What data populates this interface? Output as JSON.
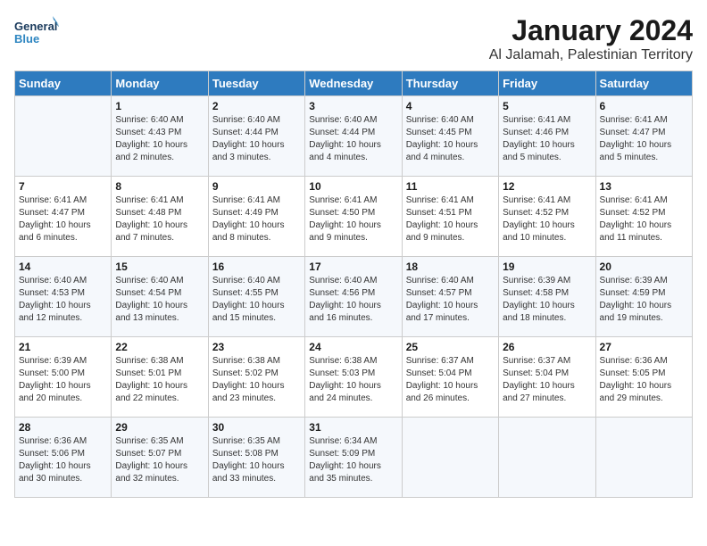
{
  "header": {
    "logo_line1": "General",
    "logo_line2": "Blue",
    "month": "January 2024",
    "location": "Al Jalamah, Palestinian Territory"
  },
  "weekdays": [
    "Sunday",
    "Monday",
    "Tuesday",
    "Wednesday",
    "Thursday",
    "Friday",
    "Saturday"
  ],
  "weeks": [
    [
      {
        "day": "",
        "info": ""
      },
      {
        "day": "1",
        "info": "Sunrise: 6:40 AM\nSunset: 4:43 PM\nDaylight: 10 hours\nand 2 minutes."
      },
      {
        "day": "2",
        "info": "Sunrise: 6:40 AM\nSunset: 4:44 PM\nDaylight: 10 hours\nand 3 minutes."
      },
      {
        "day": "3",
        "info": "Sunrise: 6:40 AM\nSunset: 4:44 PM\nDaylight: 10 hours\nand 4 minutes."
      },
      {
        "day": "4",
        "info": "Sunrise: 6:40 AM\nSunset: 4:45 PM\nDaylight: 10 hours\nand 4 minutes."
      },
      {
        "day": "5",
        "info": "Sunrise: 6:41 AM\nSunset: 4:46 PM\nDaylight: 10 hours\nand 5 minutes."
      },
      {
        "day": "6",
        "info": "Sunrise: 6:41 AM\nSunset: 4:47 PM\nDaylight: 10 hours\nand 5 minutes."
      }
    ],
    [
      {
        "day": "7",
        "info": "Sunrise: 6:41 AM\nSunset: 4:47 PM\nDaylight: 10 hours\nand 6 minutes."
      },
      {
        "day": "8",
        "info": "Sunrise: 6:41 AM\nSunset: 4:48 PM\nDaylight: 10 hours\nand 7 minutes."
      },
      {
        "day": "9",
        "info": "Sunrise: 6:41 AM\nSunset: 4:49 PM\nDaylight: 10 hours\nand 8 minutes."
      },
      {
        "day": "10",
        "info": "Sunrise: 6:41 AM\nSunset: 4:50 PM\nDaylight: 10 hours\nand 9 minutes."
      },
      {
        "day": "11",
        "info": "Sunrise: 6:41 AM\nSunset: 4:51 PM\nDaylight: 10 hours\nand 9 minutes."
      },
      {
        "day": "12",
        "info": "Sunrise: 6:41 AM\nSunset: 4:52 PM\nDaylight: 10 hours\nand 10 minutes."
      },
      {
        "day": "13",
        "info": "Sunrise: 6:41 AM\nSunset: 4:52 PM\nDaylight: 10 hours\nand 11 minutes."
      }
    ],
    [
      {
        "day": "14",
        "info": "Sunrise: 6:40 AM\nSunset: 4:53 PM\nDaylight: 10 hours\nand 12 minutes."
      },
      {
        "day": "15",
        "info": "Sunrise: 6:40 AM\nSunset: 4:54 PM\nDaylight: 10 hours\nand 13 minutes."
      },
      {
        "day": "16",
        "info": "Sunrise: 6:40 AM\nSunset: 4:55 PM\nDaylight: 10 hours\nand 15 minutes."
      },
      {
        "day": "17",
        "info": "Sunrise: 6:40 AM\nSunset: 4:56 PM\nDaylight: 10 hours\nand 16 minutes."
      },
      {
        "day": "18",
        "info": "Sunrise: 6:40 AM\nSunset: 4:57 PM\nDaylight: 10 hours\nand 17 minutes."
      },
      {
        "day": "19",
        "info": "Sunrise: 6:39 AM\nSunset: 4:58 PM\nDaylight: 10 hours\nand 18 minutes."
      },
      {
        "day": "20",
        "info": "Sunrise: 6:39 AM\nSunset: 4:59 PM\nDaylight: 10 hours\nand 19 minutes."
      }
    ],
    [
      {
        "day": "21",
        "info": "Sunrise: 6:39 AM\nSunset: 5:00 PM\nDaylight: 10 hours\nand 20 minutes."
      },
      {
        "day": "22",
        "info": "Sunrise: 6:38 AM\nSunset: 5:01 PM\nDaylight: 10 hours\nand 22 minutes."
      },
      {
        "day": "23",
        "info": "Sunrise: 6:38 AM\nSunset: 5:02 PM\nDaylight: 10 hours\nand 23 minutes."
      },
      {
        "day": "24",
        "info": "Sunrise: 6:38 AM\nSunset: 5:03 PM\nDaylight: 10 hours\nand 24 minutes."
      },
      {
        "day": "25",
        "info": "Sunrise: 6:37 AM\nSunset: 5:04 PM\nDaylight: 10 hours\nand 26 minutes."
      },
      {
        "day": "26",
        "info": "Sunrise: 6:37 AM\nSunset: 5:04 PM\nDaylight: 10 hours\nand 27 minutes."
      },
      {
        "day": "27",
        "info": "Sunrise: 6:36 AM\nSunset: 5:05 PM\nDaylight: 10 hours\nand 29 minutes."
      }
    ],
    [
      {
        "day": "28",
        "info": "Sunrise: 6:36 AM\nSunset: 5:06 PM\nDaylight: 10 hours\nand 30 minutes."
      },
      {
        "day": "29",
        "info": "Sunrise: 6:35 AM\nSunset: 5:07 PM\nDaylight: 10 hours\nand 32 minutes."
      },
      {
        "day": "30",
        "info": "Sunrise: 6:35 AM\nSunset: 5:08 PM\nDaylight: 10 hours\nand 33 minutes."
      },
      {
        "day": "31",
        "info": "Sunrise: 6:34 AM\nSunset: 5:09 PM\nDaylight: 10 hours\nand 35 minutes."
      },
      {
        "day": "",
        "info": ""
      },
      {
        "day": "",
        "info": ""
      },
      {
        "day": "",
        "info": ""
      }
    ]
  ]
}
